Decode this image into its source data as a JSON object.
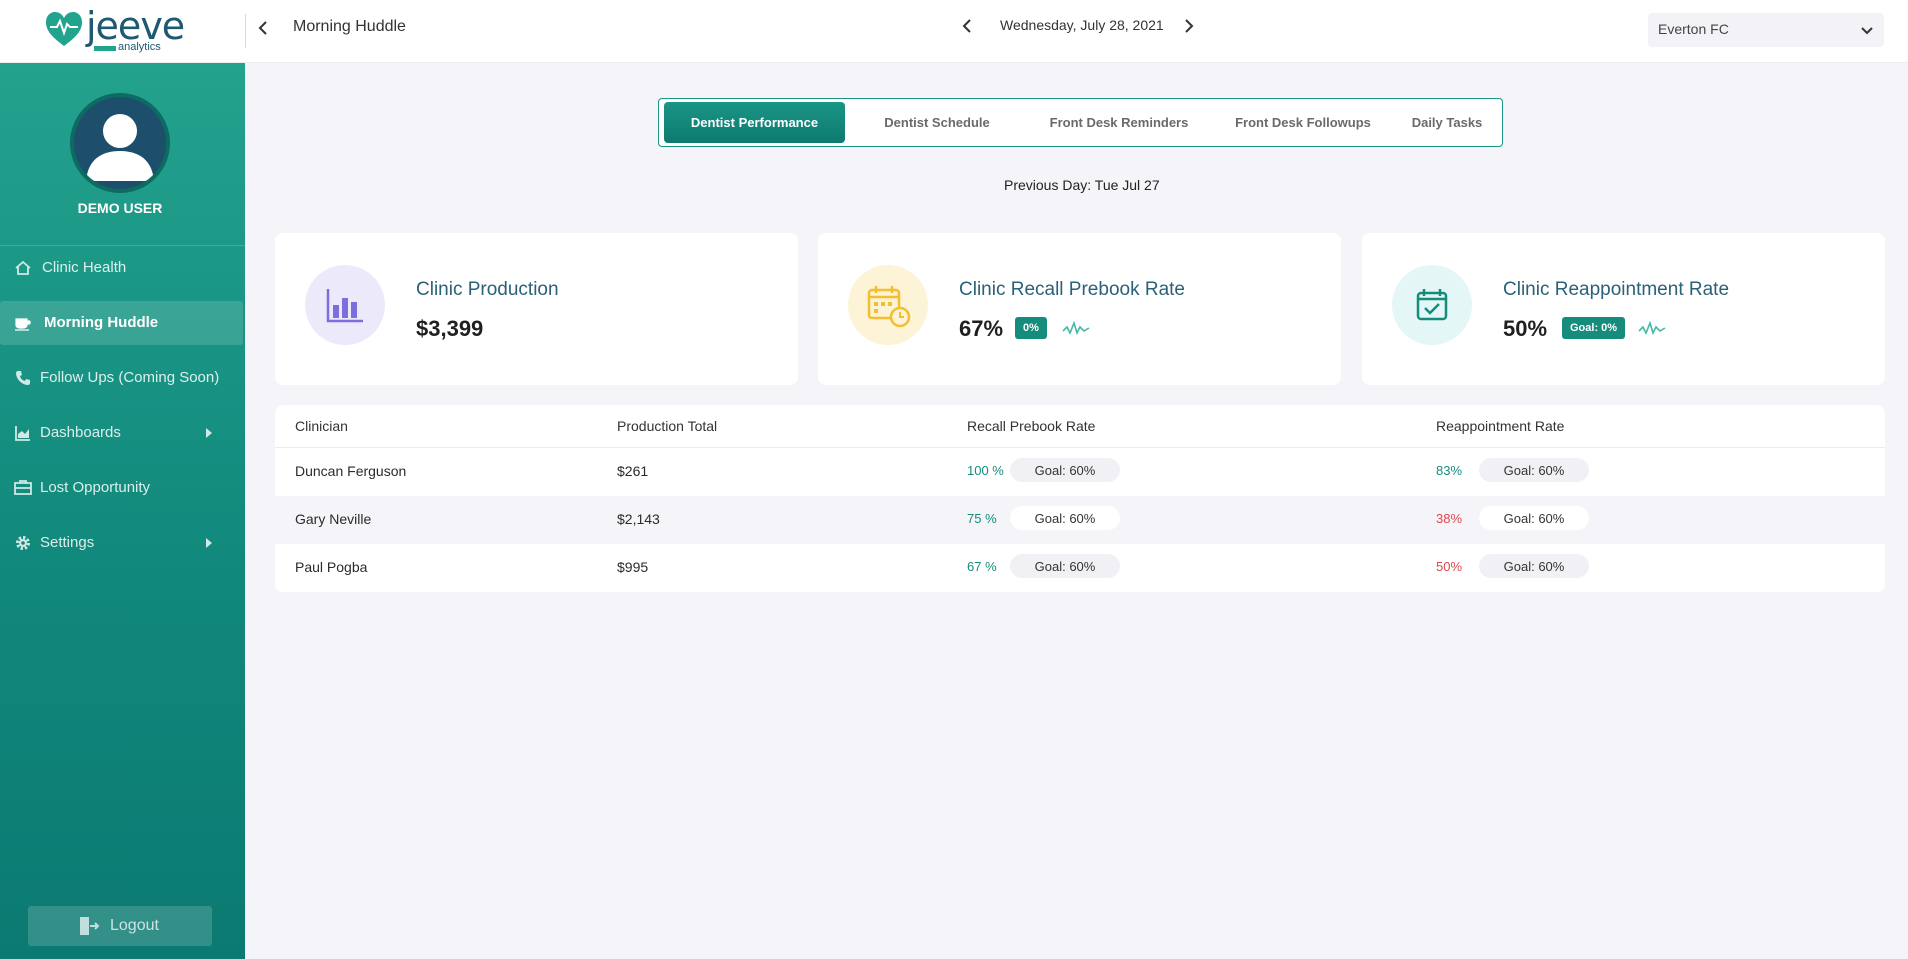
{
  "brand": {
    "name": "jeeve",
    "sub": "analytics"
  },
  "header": {
    "page_title": "Morning Huddle",
    "date": "Wednesday, July 28, 2021",
    "clinic_selected": "Everton FC"
  },
  "sidebar": {
    "user_name": "DEMO USER",
    "items": [
      {
        "label": "Clinic Health",
        "icon": "home-icon"
      },
      {
        "label": "Morning Huddle",
        "icon": "coffee-cup-icon"
      },
      {
        "label": "Follow Ups (Coming Soon)",
        "icon": "phone-icon"
      },
      {
        "label": "Dashboards",
        "icon": "chart-area-icon"
      },
      {
        "label": "Lost Opportunity",
        "icon": "briefcase-icon"
      },
      {
        "label": "Settings",
        "icon": "gear-icon"
      }
    ],
    "logout_label": "Logout"
  },
  "tabs": [
    {
      "label": "Dentist Performance",
      "active": true
    },
    {
      "label": "Dentist Schedule",
      "active": false
    },
    {
      "label": "Front Desk Reminders",
      "active": false
    },
    {
      "label": "Front Desk Followups",
      "active": false
    },
    {
      "label": "Daily Tasks",
      "active": false
    }
  ],
  "previous_day": "Previous Day: Tue Jul 27",
  "kpis": [
    {
      "title": "Clinic Production",
      "value": "$3,399",
      "icon": "bar-chart-icon",
      "color": "#ece9fb"
    },
    {
      "title": "Clinic Recall Prebook Rate",
      "value": "67%",
      "badge": "0%",
      "icon": "calendar-clock-icon",
      "color": "#fdf3d6"
    },
    {
      "title": "Clinic Reappointment Rate",
      "value": "50%",
      "badge": "Goal: 0%",
      "icon": "calendar-check-icon",
      "color": "#e4f7f6"
    }
  ],
  "table": {
    "headers": [
      "Clinician",
      "Production Total",
      "Recall Prebook Rate",
      "Reappointment Rate"
    ],
    "rows": [
      {
        "clinician": "Duncan Ferguson",
        "production": "$261",
        "recall": "100 %",
        "recall_goal": "Goal: 60%",
        "reappt": "83%",
        "reappt_goal": "Goal: 60%",
        "reappt_status": "good"
      },
      {
        "clinician": "Gary Neville",
        "production": "$2,143",
        "recall": "75 %",
        "recall_goal": "Goal: 60%",
        "reappt": "38%",
        "reappt_goal": "Goal: 60%",
        "reappt_status": "bad"
      },
      {
        "clinician": "Paul Pogba",
        "production": "$995",
        "recall": "67 %",
        "recall_goal": "Goal: 60%",
        "reappt": "50%",
        "reappt_goal": "Goal: 60%",
        "reappt_status": "bad"
      }
    ]
  },
  "colors": {
    "accent": "#168d7c",
    "danger": "#e0464f",
    "sidebar": "#11897c"
  }
}
